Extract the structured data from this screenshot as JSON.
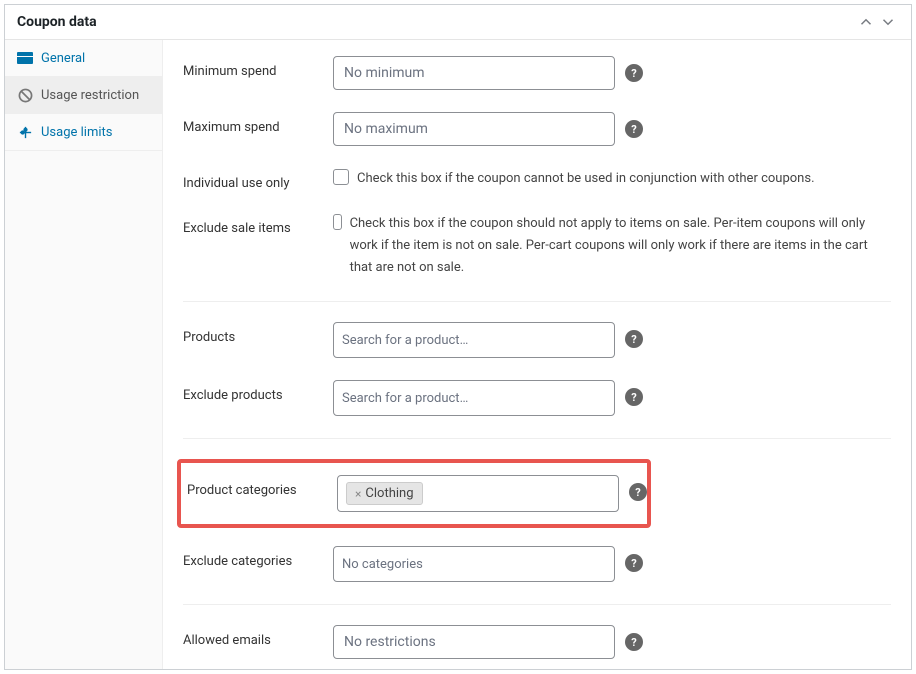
{
  "panel": {
    "title": "Coupon data"
  },
  "sidebar": {
    "items": [
      {
        "label": "General"
      },
      {
        "label": "Usage restriction"
      },
      {
        "label": "Usage limits"
      }
    ]
  },
  "fields": {
    "min_spend": {
      "label": "Minimum spend",
      "placeholder": "No minimum"
    },
    "max_spend": {
      "label": "Maximum spend",
      "placeholder": "No maximum"
    },
    "individual_use": {
      "label": "Individual use only",
      "desc": "Check this box if the coupon cannot be used in conjunction with other coupons."
    },
    "exclude_sale": {
      "label": "Exclude sale items",
      "desc": "Check this box if the coupon should not apply to items on sale. Per-item coupons will only work if the item is not on sale. Per-cart coupons will only work if there are items in the cart that are not on sale."
    },
    "products": {
      "label": "Products",
      "placeholder": "Search for a product…"
    },
    "exclude_products": {
      "label": "Exclude products",
      "placeholder": "Search for a product…"
    },
    "product_categories": {
      "label": "Product categories",
      "tag": "Clothing"
    },
    "exclude_categories": {
      "label": "Exclude categories",
      "placeholder": "No categories"
    },
    "allowed_emails": {
      "label": "Allowed emails",
      "placeholder": "No restrictions"
    }
  }
}
